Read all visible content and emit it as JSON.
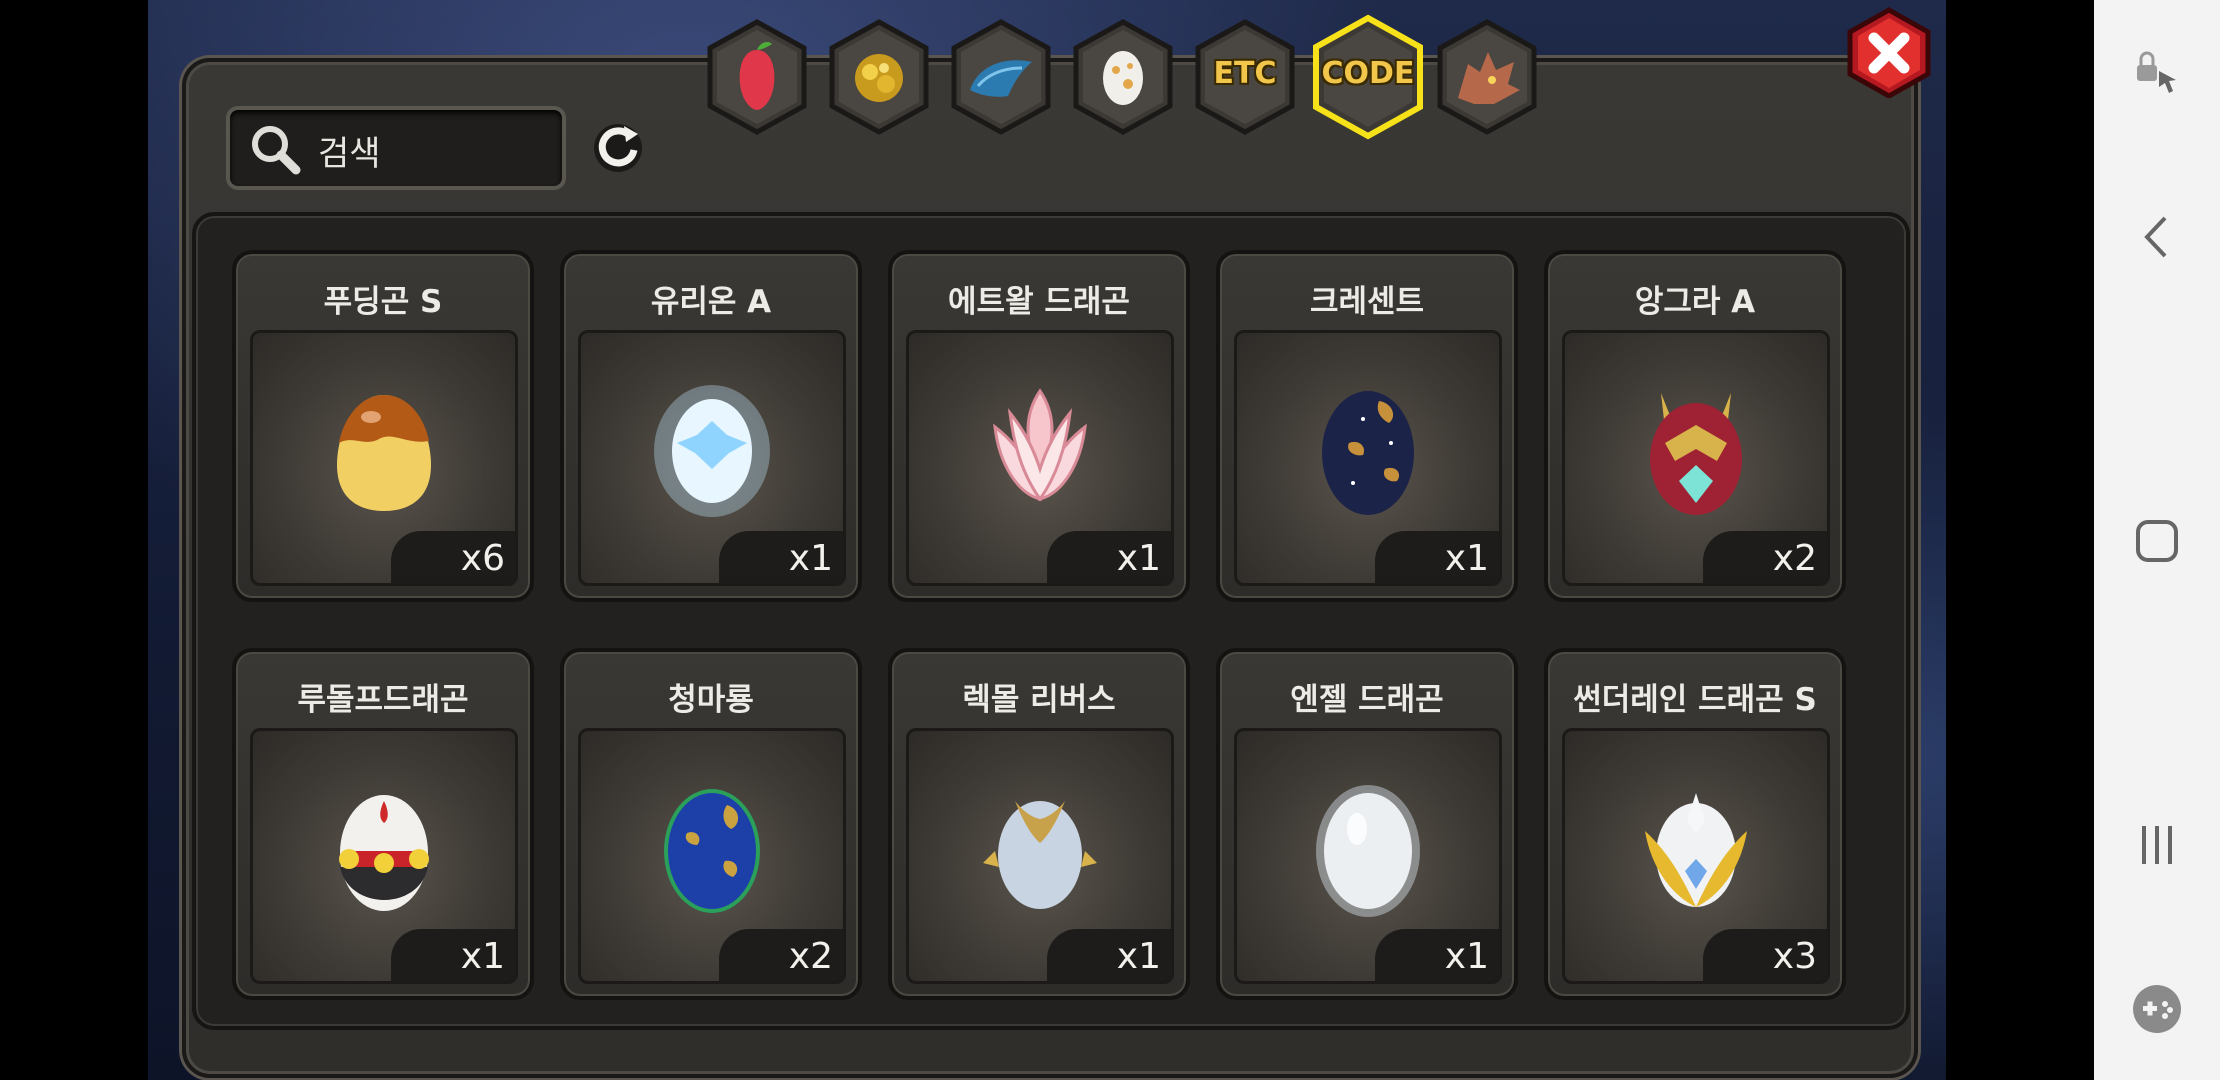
{
  "search": {
    "placeholder": "검색"
  },
  "tabs": [
    {
      "name": "fruit",
      "label": ""
    },
    {
      "name": "gold-ore",
      "label": ""
    },
    {
      "name": "dragon-scale",
      "label": ""
    },
    {
      "name": "egg",
      "label": ""
    },
    {
      "name": "etc",
      "label": "ETC"
    },
    {
      "name": "code",
      "label": "CODE",
      "active": true
    },
    {
      "name": "dragon-head",
      "label": ""
    }
  ],
  "items": [
    {
      "name": "푸딩곤 S",
      "count": "x6",
      "icon": "pudding-egg-icon"
    },
    {
      "name": "유리온 A",
      "count": "x1",
      "icon": "glowing-egg-icon"
    },
    {
      "name": "에트왈 드래곤",
      "count": "x1",
      "icon": "lotus-egg-icon"
    },
    {
      "name": "크레센트",
      "count": "x1",
      "icon": "starry-egg-icon"
    },
    {
      "name": "앙그라 A",
      "count": "x2",
      "icon": "horned-red-egg-icon"
    },
    {
      "name": "루돌프드래곤",
      "count": "x1",
      "icon": "bell-egg-icon"
    },
    {
      "name": "청마룡",
      "count": "x2",
      "icon": "blue-gold-egg-icon"
    },
    {
      "name": "렉몰 리버스",
      "count": "x1",
      "icon": "silver-egg-icon"
    },
    {
      "name": "엔젤 드래곤",
      "count": "x1",
      "icon": "white-egg-icon"
    },
    {
      "name": "썬더레인 드래곤 S",
      "count": "x3",
      "icon": "gold-winged-egg-icon"
    }
  ],
  "colors": {
    "accent": "#f1c64a",
    "close": "#d9232b",
    "panel": "#33312e"
  }
}
